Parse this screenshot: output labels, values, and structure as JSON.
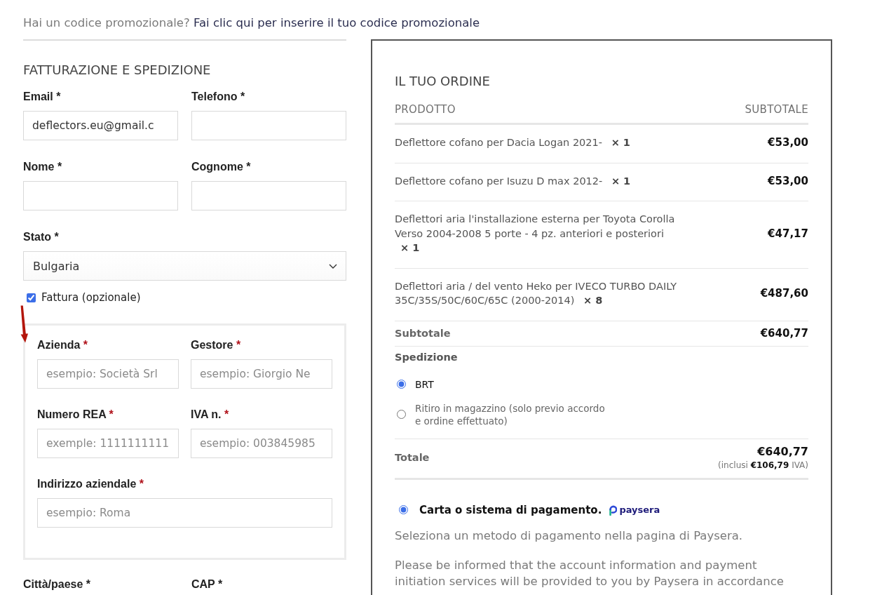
{
  "promo": {
    "question": "Hai un codice promozionale?",
    "link": "Fai clic qui per inserire il tuo codice promozionale"
  },
  "billing": {
    "title": "FATTURAZIONE E SPEDIZIONE",
    "rows": [
      [
        {
          "kind": "text",
          "label": "Email",
          "mark": "*",
          "value": "deflectors.eu@gmail.c"
        },
        {
          "kind": "text",
          "label": "Telefono",
          "mark": "*"
        }
      ],
      [
        {
          "kind": "text",
          "label": "Nome",
          "mark": "*"
        },
        {
          "kind": "text",
          "label": "Cognome",
          "mark": "*"
        }
      ],
      [
        {
          "kind": "select",
          "label": "Stato",
          "mark": "*",
          "value": "Bulgaria"
        }
      ]
    ],
    "invoice_toggle": {
      "label": "Fattura (opzionale)",
      "checked": true
    },
    "invoice_rows": [
      [
        {
          "label": "Azienda",
          "mark": "*",
          "placeholder": "esempio: Società Srl"
        },
        {
          "label": "Gestore",
          "mark": "*",
          "placeholder": "esempio: Giorgio Ne"
        }
      ],
      [
        {
          "label": "Numero REA",
          "mark": "*",
          "placeholder": "exemple: 1111111111"
        },
        {
          "label": "IVA n.",
          "mark": "*",
          "placeholder": "esempio: 003845985"
        }
      ],
      [
        {
          "label": "Indirizzo aziendale",
          "mark": "*",
          "placeholder": "esempio: Roma"
        }
      ]
    ],
    "labels_below": [
      {
        "label": "Città/paese",
        "mark": "*"
      },
      {
        "label": "CAP",
        "mark": "*"
      }
    ]
  },
  "order": {
    "title": "IL TUO ORDINE",
    "columns": [
      "PRODOTTO",
      "SUBTOTALE"
    ],
    "items": [
      {
        "name": "Deflettore cofano per Dacia Logan 2021-",
        "quantity": "× 1",
        "price": "€53,00"
      },
      {
        "name": "Deflettore cofano per Isuzu D max 2012-",
        "quantity": "× 1",
        "price": "€53,00"
      },
      {
        "name": "Deflettori aria l'installazione esterna per Toyota Corolla Verso 2004-2008 5 porte - 4 pz. anteriori e posteriori",
        "quantity": "× 1",
        "price": "€47,17"
      },
      {
        "name": "Deflettori aria / del vento Heko per IVECO TURBO DAILY 35C/35S/50C/60C/65C (2000-2014)",
        "quantity": "× 8",
        "price": "€487,60"
      }
    ],
    "subtotal": {
      "label": "Subtotale",
      "value": "€640,77"
    },
    "shipping": {
      "label": "Spedizione",
      "options": [
        {
          "label": "BRT",
          "selected": true
        },
        {
          "label": "Ritiro in magazzino (solo previo accordo e ordine effettuato)",
          "selected": false
        }
      ]
    },
    "total": {
      "label": "Totale",
      "value": "€640,77",
      "tax_note": "(inclusi **€106,79** IVA)"
    }
  },
  "payment": {
    "methods": [
      {
        "label": "Carta o sistema di pagamento.",
        "logo": "paysera",
        "selected": true
      }
    ],
    "description": "Seleziona un metodo di pagamento nella pagina di Paysera.",
    "notice": "Please be informed that the account information and payment initiation services will be provided to you by Paysera in accordance"
  }
}
